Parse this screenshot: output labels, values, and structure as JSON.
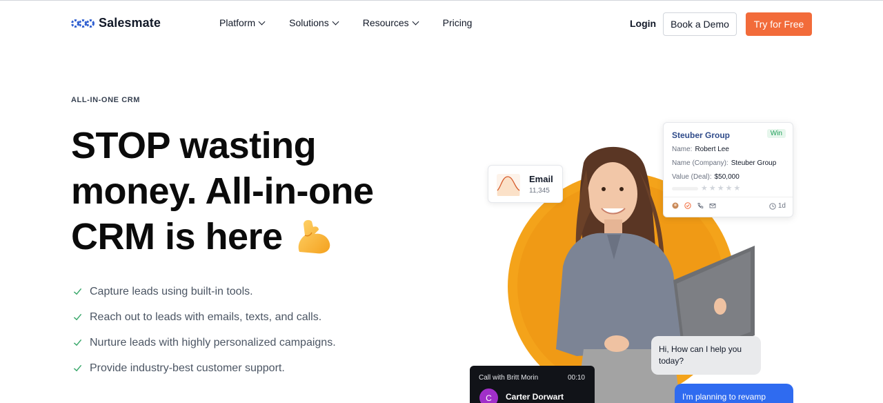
{
  "brand": {
    "name": "Salesmate",
    "accent": "#f26b3a",
    "blue": "#2f4b8a"
  },
  "nav": {
    "items": [
      {
        "label": "Platform",
        "has_dropdown": true
      },
      {
        "label": "Solutions",
        "has_dropdown": true
      },
      {
        "label": "Resources",
        "has_dropdown": true
      },
      {
        "label": "Pricing",
        "has_dropdown": false
      }
    ],
    "login": "Login",
    "demo": "Book a Demo",
    "try": "Try for Free"
  },
  "hero": {
    "eyebrow": "ALL-IN-ONE CRM",
    "headline_line1": "STOP wasting",
    "headline_line2": "money. All-in-one",
    "headline_line3": "CRM is here",
    "emoji": "flexed-biceps-icon",
    "features": [
      "Capture leads using built-in tools.",
      "Reach out to leads with emails, texts, and calls.",
      "Nurture leads with highly personalized campaigns.",
      "Provide industry-best customer support."
    ]
  },
  "visual": {
    "email_card": {
      "title": "Email",
      "count": "11,345"
    },
    "deal_card": {
      "title": "Steuber Group",
      "badge": "Win",
      "name_label": "Name:",
      "name_value": "Robert Lee",
      "company_label": "Name (Company):",
      "company_value": "Steuber Group",
      "value_label": "Value (Deal):",
      "value_value": "$50,000",
      "time": "1d"
    },
    "bubble_grey": "Hi, How can I help you today?",
    "bubble_blue": "I'm planning to revamp",
    "call_card": {
      "label": "Call with Britt Morin",
      "time": "00:10",
      "avatar_initial": "C",
      "name": "Carter Dorwart"
    }
  }
}
